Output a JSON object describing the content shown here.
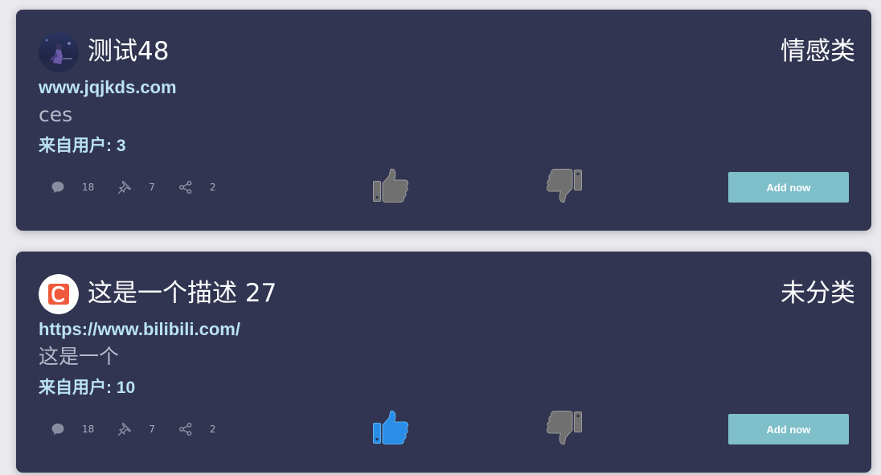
{
  "cards": [
    {
      "title": "测试48",
      "category": "情感类",
      "url": "www.jqjkds.com",
      "description": "ces",
      "from_user": "来自用户: 3",
      "stats": {
        "comments": "18",
        "pins": "7",
        "shares": "2"
      },
      "liked": false,
      "add_label": "Add now",
      "avatar_icon": "user-avatar-photo"
    },
    {
      "title": "这是一个描述 27",
      "category": "未分类",
      "url": "https://www.bilibili.com/",
      "description": "这是一个",
      "from_user": "来自用户: 10",
      "stats": {
        "comments": "18",
        "pins": "7",
        "shares": "2"
      },
      "liked": true,
      "add_label": "Add now",
      "avatar_icon": "c-logo-avatar"
    }
  ],
  "colors": {
    "card_bg": "#323551",
    "link": "#b9e2f2",
    "thumb_inactive": "#707070",
    "thumb_active": "#2a8ee8",
    "button": "#7fbfc9"
  }
}
